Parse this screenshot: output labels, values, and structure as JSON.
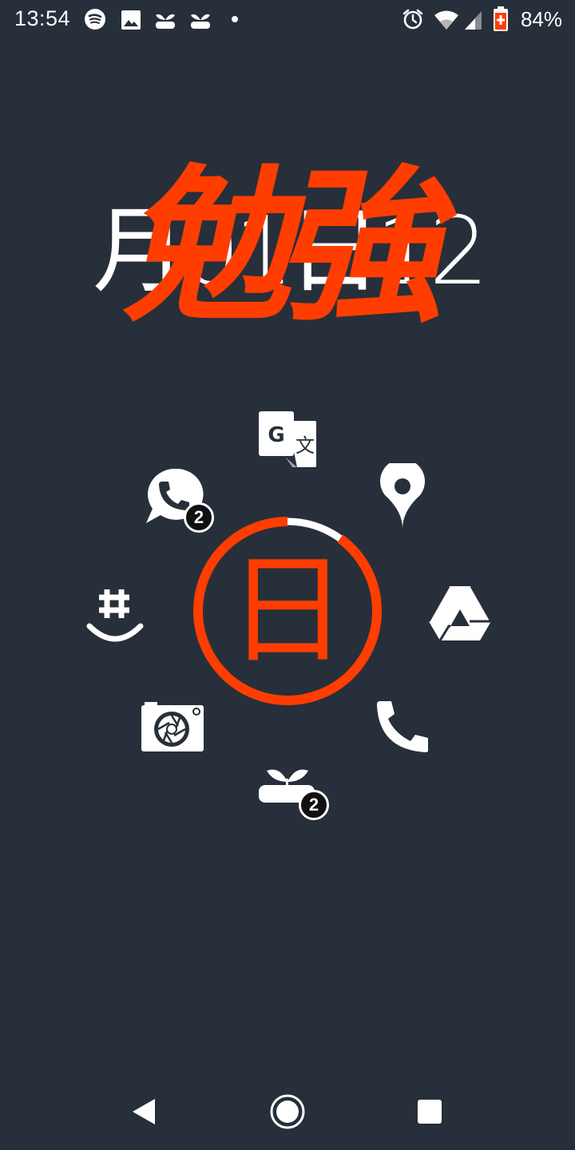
{
  "status_bar": {
    "time": "13:54",
    "battery": "84%",
    "left_icons": [
      "spotify-icon",
      "image-icon",
      "sprout-icon",
      "sprout-icon",
      "dot-icon"
    ],
    "right_icons": [
      "alarm-icon",
      "wifi-icon",
      "signal-icon",
      "battery-icon"
    ]
  },
  "clock": {
    "date": "月01日12",
    "overlay": "勉強"
  },
  "launcher": {
    "center_label": "日",
    "center_progress": 0.9,
    "apps": [
      {
        "name": "Google Translate",
        "icon": "translate-icon"
      },
      {
        "name": "Maps",
        "icon": "map-pin-icon"
      },
      {
        "name": "Drive",
        "icon": "drive-icon"
      },
      {
        "name": "Phone",
        "icon": "phone-icon"
      },
      {
        "name": "Forest",
        "icon": "sprout-icon",
        "badge": "2"
      },
      {
        "name": "Camera",
        "icon": "camera-icon"
      },
      {
        "name": "GroupMe",
        "icon": "groupme-icon"
      },
      {
        "name": "WhatsApp",
        "icon": "whatsapp-icon",
        "badge": "2"
      }
    ]
  },
  "colors": {
    "background": "#272f3a",
    "accent": "#ff3d00",
    "foreground": "#ffffff"
  },
  "nav": {
    "buttons": [
      "back-icon",
      "home-icon",
      "recents-icon"
    ]
  }
}
